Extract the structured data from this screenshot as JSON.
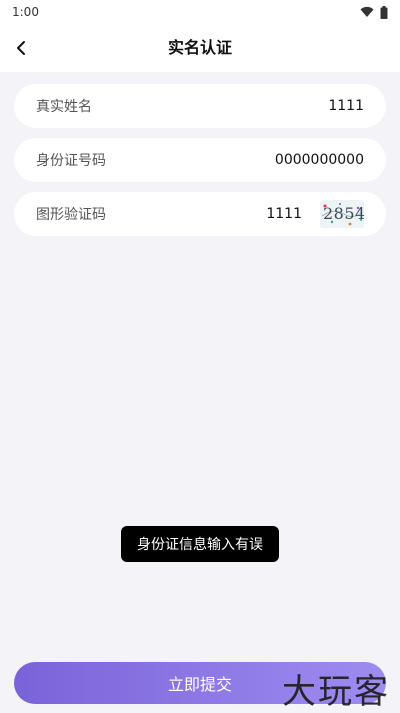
{
  "status": {
    "time": "1:00"
  },
  "header": {
    "title": "实名认证"
  },
  "form": {
    "name_label": "真实姓名",
    "name_value": "1111",
    "id_label": "身份证号码",
    "id_value": "0000000000",
    "captcha_label": "图形验证码",
    "captcha_value": "1111",
    "captcha_image_text": "2854"
  },
  "toast": {
    "message": "身份证信息输入有误"
  },
  "submit": {
    "label": "立即提交"
  },
  "watermark": {
    "text": "大玩客"
  },
  "colors": {
    "accent_start": "#7a63d9",
    "accent_end": "#9f8cf0",
    "background": "#f4f3f8"
  }
}
